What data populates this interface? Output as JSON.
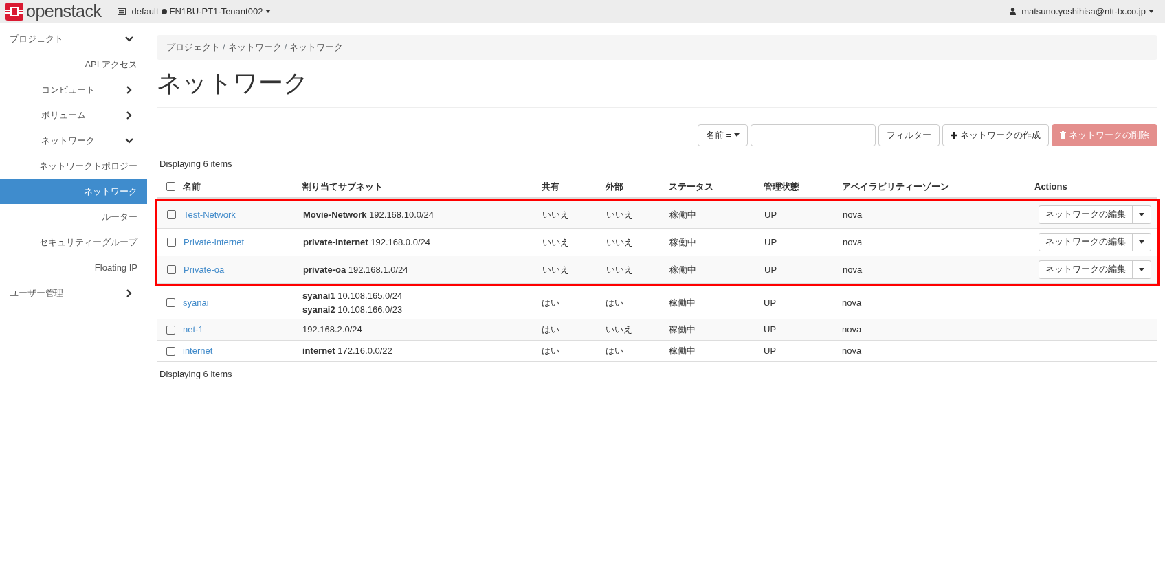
{
  "topbar": {
    "logo_text": "openstack",
    "domain": "default",
    "project": "FN1BU-PT1-Tenant002",
    "user": "matsuno.yoshihisa@ntt-tx.co.jp"
  },
  "sidebar": {
    "items": [
      {
        "label": "プロジェクト",
        "expanded": true,
        "children": [
          {
            "label": "API アクセス",
            "selected": false
          },
          {
            "label": "コンピュート",
            "expanded": false
          },
          {
            "label": "ボリューム",
            "expanded": false
          },
          {
            "label": "ネットワーク",
            "expanded": true,
            "children": [
              {
                "label": "ネットワークトポロジー",
                "selected": false
              },
              {
                "label": "ネットワーク",
                "selected": true
              },
              {
                "label": "ルーター",
                "selected": false
              },
              {
                "label": "セキュリティーグループ",
                "selected": false
              },
              {
                "label": "Floating IP",
                "selected": false
              }
            ]
          }
        ]
      },
      {
        "label": "ユーザー管理",
        "expanded": false
      }
    ]
  },
  "breadcrumb": {
    "separator": "/",
    "items": [
      "プロジェクト",
      "ネットワーク",
      "ネットワーク"
    ]
  },
  "page_title": "ネットワーク",
  "toolbar": {
    "filter_field": "名前 =",
    "filter_button": "フィルター",
    "create_button": "ネットワークの作成",
    "delete_button": {
      "label": "ネットワークの削除",
      "disabled": true
    }
  },
  "count_top": "Displaying 6 items",
  "table": {
    "select_all_checked": false,
    "columns": [
      "名前",
      "割り当てサブネット",
      "共有",
      "外部",
      "ステータス",
      "管理状態",
      "アベイラビリティーゾーン",
      "Actions"
    ],
    "rows": [
      {
        "name": "Test-Network",
        "subnets": [
          "**Movie-Network** 192.168.10.0/24"
        ],
        "shared": "いいえ",
        "external": "いいえ",
        "status": "稼働中",
        "admin_state": "UP",
        "zone": "nova",
        "action": "ネットワークの編集",
        "checked": false,
        "highlighted": true
      },
      {
        "name": "Private-internet",
        "subnets": [
          "**private-internet** 192.168.0.0/24"
        ],
        "shared": "いいえ",
        "external": "いいえ",
        "status": "稼働中",
        "admin_state": "UP",
        "zone": "nova",
        "action": "ネットワークの編集",
        "checked": false,
        "highlighted": true
      },
      {
        "name": "Private-oa",
        "subnets": [
          "**private-oa** 192.168.1.0/24"
        ],
        "shared": "いいえ",
        "external": "いいえ",
        "status": "稼働中",
        "admin_state": "UP",
        "zone": "nova",
        "action": "ネットワークの編集",
        "checked": false,
        "highlighted": true
      },
      {
        "name": "syanai",
        "subnets": [
          "**syanai1** 10.108.165.0/24",
          "**syanai2** 10.108.166.0/23"
        ],
        "shared": "はい",
        "external": "はい",
        "status": "稼働中",
        "admin_state": "UP",
        "zone": "nova",
        "checked": false,
        "highlighted": false
      },
      {
        "name": "net-1",
        "subnets": [
          "192.168.2.0/24"
        ],
        "shared": "はい",
        "external": "いいえ",
        "status": "稼働中",
        "admin_state": "UP",
        "zone": "nova",
        "checked": false,
        "highlighted": false
      },
      {
        "name": "internet",
        "subnets": [
          "**internet** 172.16.0.0/22"
        ],
        "shared": "はい",
        "external": "はい",
        "status": "稼働中",
        "admin_state": "UP",
        "zone": "nova",
        "checked": false,
        "highlighted": false
      }
    ]
  },
  "count_bottom": "Displaying 6 items"
}
